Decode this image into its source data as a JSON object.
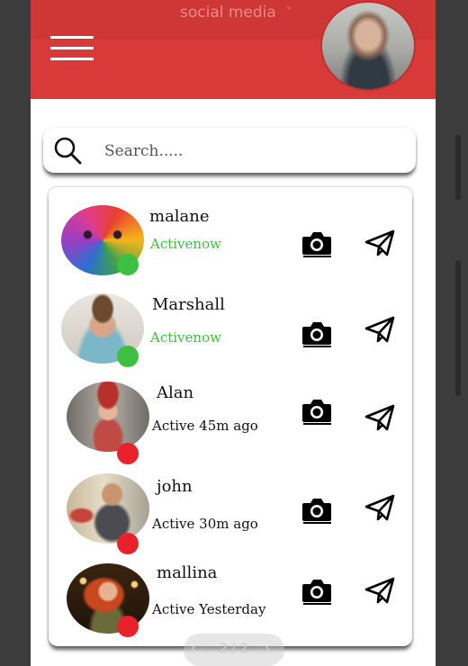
{
  "header": {
    "app_title": "social media",
    "title_caret": "˅"
  },
  "search": {
    "placeholder": "Search....."
  },
  "contacts": [
    {
      "name": "malane",
      "status": "Activenow",
      "online": true
    },
    {
      "name": "Marshall",
      "status": "Activenow",
      "online": true
    },
    {
      "name": "Alan",
      "status": "Active 45m ago",
      "online": false
    },
    {
      "name": "john",
      "status": "Active 30m ago",
      "online": false
    },
    {
      "name": "mallina",
      "status": "Active Yesterday",
      "online": false
    }
  ],
  "pagination": {
    "prev": "‹",
    "label": "2 / 2",
    "next": "›"
  },
  "colors": {
    "header_red": "#d83a3a",
    "online_green": "#3fbf3f",
    "offline_red": "#e8222b",
    "active_text_green": "#3cbf3c"
  },
  "icons": [
    "menu-icon",
    "search-icon",
    "camera-icon",
    "send-icon"
  ]
}
